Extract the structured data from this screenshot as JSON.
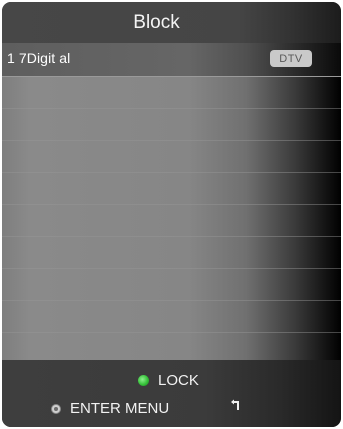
{
  "header": {
    "title": "Block"
  },
  "channel_list": {
    "items": [
      {
        "name": "1 7Digit al",
        "badge": "DTV"
      }
    ]
  },
  "footer": {
    "lock_label": "LOCK",
    "enter_menu_label": "ENTER MENU",
    "lock_indicator_color": "#36c23a",
    "icons": {
      "lock": "green-dot-icon",
      "enter_menu": "menu-button-icon",
      "back": "return-arrow-icon"
    }
  }
}
